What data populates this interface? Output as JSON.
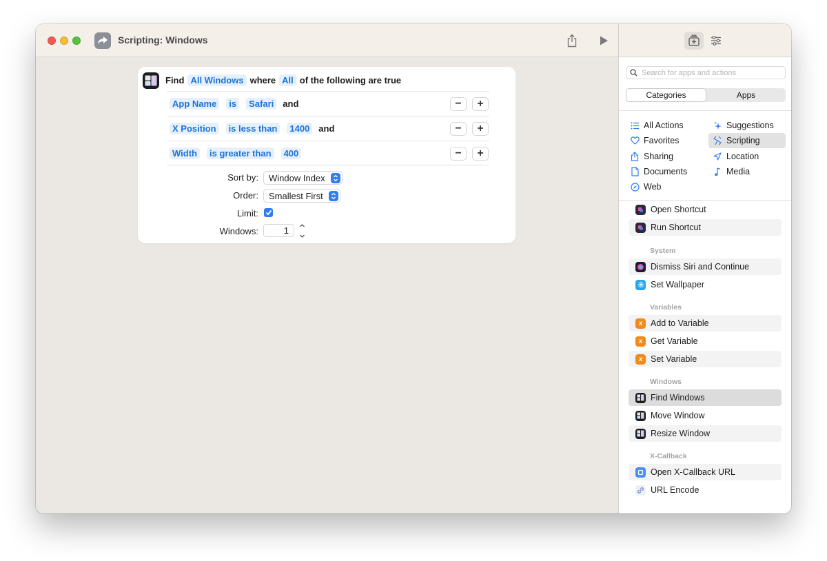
{
  "window": {
    "title": "Scripting: Windows"
  },
  "action": {
    "find_label": "Find",
    "target": "All Windows",
    "where_label": "where",
    "quantifier": "All",
    "suffix": "of the following are true",
    "conditions": [
      {
        "field": "App Name",
        "operator": "is",
        "value": "Safari",
        "joiner": "and"
      },
      {
        "field": "X Position",
        "operator": "is less than",
        "value": "1400",
        "joiner": "and"
      },
      {
        "field": "Width",
        "operator": "is greater than",
        "value": "400",
        "joiner": ""
      }
    ],
    "sort_by_label": "Sort by:",
    "sort_by_value": "Window Index",
    "order_label": "Order:",
    "order_value": "Smallest First",
    "limit_label": "Limit:",
    "limit_checked": true,
    "windows_label": "Windows:",
    "windows_value": "1"
  },
  "sidebar": {
    "search_placeholder": "Search for apps and actions",
    "segments": [
      "Categories",
      "Apps"
    ],
    "active_segment": "Categories",
    "categories": [
      {
        "label": "All Actions",
        "icon": "list-icon"
      },
      {
        "label": "Suggestions",
        "icon": "sparkles-icon"
      },
      {
        "label": "Favorites",
        "icon": "heart-icon"
      },
      {
        "label": "Scripting",
        "icon": "scripting-icon",
        "selected": true
      },
      {
        "label": "Sharing",
        "icon": "share-icon"
      },
      {
        "label": "Location",
        "icon": "location-arrow-icon"
      },
      {
        "label": "Documents",
        "icon": "document-icon"
      },
      {
        "label": "Media",
        "icon": "music-note-icon"
      },
      {
        "label": "Web",
        "icon": "compass-icon"
      }
    ],
    "actions_top": [
      "Open Shortcut",
      "Run Shortcut"
    ],
    "sections": [
      {
        "header": "System",
        "items": [
          "Dismiss Siri and Continue",
          "Set Wallpaper"
        ]
      },
      {
        "header": "Variables",
        "items": [
          "Add to Variable",
          "Get Variable",
          "Set Variable"
        ]
      },
      {
        "header": "Windows",
        "items": [
          "Find Windows",
          "Move Window",
          "Resize Window"
        ]
      },
      {
        "header": "X-Callback",
        "items": [
          "Open X-Callback URL",
          "URL Encode"
        ]
      }
    ],
    "selected_action": "Find Windows"
  },
  "colors": {
    "accent": "#2f7ef3",
    "token_text": "#1a73d9",
    "variable_orange": "#f08a1d"
  }
}
